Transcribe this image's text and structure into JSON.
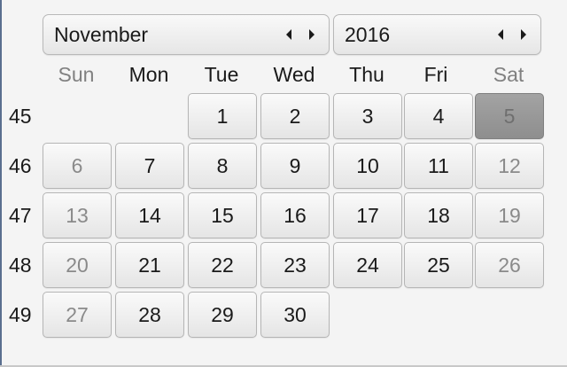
{
  "month_spinner": {
    "value": "November"
  },
  "year_spinner": {
    "value": "2016"
  },
  "weekdays": [
    "Sun",
    "Mon",
    "Tue",
    "Wed",
    "Thu",
    "Fri",
    "Sat"
  ],
  "weeks": [
    {
      "number": "45",
      "days": [
        "",
        "",
        "1",
        "2",
        "3",
        "4",
        "5"
      ]
    },
    {
      "number": "46",
      "days": [
        "6",
        "7",
        "8",
        "9",
        "10",
        "11",
        "12"
      ]
    },
    {
      "number": "47",
      "days": [
        "13",
        "14",
        "15",
        "16",
        "17",
        "18",
        "19"
      ]
    },
    {
      "number": "48",
      "days": [
        "20",
        "21",
        "22",
        "23",
        "24",
        "25",
        "26"
      ]
    },
    {
      "number": "49",
      "days": [
        "27",
        "28",
        "29",
        "30",
        "",
        "",
        ""
      ]
    }
  ],
  "selected_day": "5",
  "icons": {
    "prev": "triangle-left-icon",
    "next": "triangle-right-icon"
  },
  "colors": {
    "weekend_text": "#808080",
    "selected_fill": "#999999"
  }
}
